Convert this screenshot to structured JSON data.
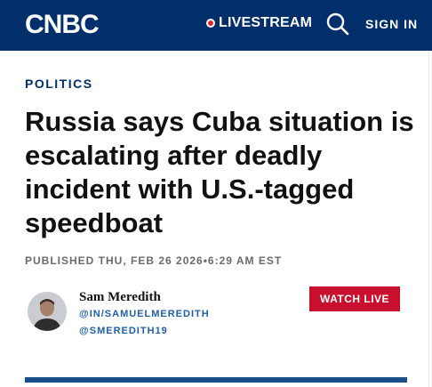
{
  "header": {
    "logo_text": "CNBC",
    "livestream_label": "LIVESTREAM",
    "search_icon": "search-icon",
    "signin_label": "SIGN IN",
    "bg_color": "#002f6c",
    "live_dot_color": "#e6262b"
  },
  "article": {
    "category": "POLITICS",
    "headline": "Russia says Cuba situation is escalating after deadly incident with U.S.-tagged speedboat",
    "published": "PUBLISHED THU, FEB 26 2026•6:29 AM EST"
  },
  "author": {
    "name": "Sam Meredith",
    "linkedin": "@IN/SAMUELMEREDITH",
    "twitter": "@SMEREDITH19"
  },
  "actions": {
    "watch_live_label": "WATCH LIVE",
    "watch_live_color": "#c8102e"
  }
}
